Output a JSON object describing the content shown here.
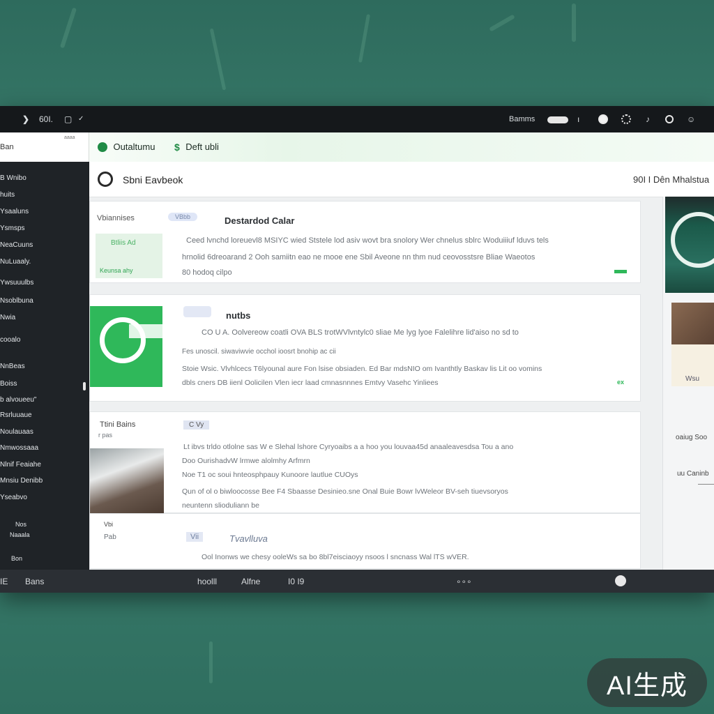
{
  "topbar": {
    "left_label": "60I.",
    "right_label": "Bamms"
  },
  "tabbar": {
    "left_label": "Ban",
    "left_sub": "aaaa",
    "tab1_label": "Outaltumu",
    "tab2_label": "Deft ubli"
  },
  "sidebar": {
    "items": [
      "B Wnibo",
      "huits",
      "Ysaaluns",
      "Ysmsps",
      "NeaCuuns",
      "NuLuaaly.",
      "Ywsuuulbs",
      "Nsoblbuna",
      "Nwia",
      "cooalo",
      "NnBeas",
      "Boiss",
      "b alvoueeu\"",
      "Rsrluuaue",
      "Noulauaas",
      "Nmwossaaa",
      "Nlnif Feaiahe",
      "Mnsiu Denibb",
      "Yseabvo",
      "Nos",
      "Naaala",
      "Bon"
    ]
  },
  "header": {
    "title": "Sbni Eavbeok",
    "right_text": "90I I Dên Mhalstua"
  },
  "cards": {
    "card1": {
      "label": "Vbiannises",
      "chip": "VBbb",
      "title": "Destardod Calar",
      "lines": [
        "Ceed lvnchd loreuevl8 MSIYC wied  Ststele lod asiv wovt bra snolory Wer chnelus sblrc Woduiiiuf lduvs tels",
        "hrnolid 6dreoarand  2  Ooh samiitn eao ne mooe ene  Sbil Aveone nn thm nud ceovosstsre Bliae Waeotos",
        "80 hodoq cilpo"
      ],
      "img_text": "Btliis Ad",
      "img_sub": "Keunsa  ahy"
    },
    "card2": {
      "title": "nutbs",
      "lines": [
        "CO U  A.   Oolvereow coatli OVA BLS trotWVlvntylc0 sliae Me lyg lyoe Falelihre lid'aiso no sd to",
        "Fes   unoscil. siwaviwvie    occhol  ioosrt bnohip ac cii",
        "Stoie Wsic. Vlvhlcecs  T6lyounal aure  Fon lsise obsiaden. Ed Bar mdsNIO om Ivanthtly Baskav lis Lit  oo vomins",
        "dbls   cners DB iienl  Oolicilen  Vlen iecr laad cmnasnnnes Emtvy Vasehc Yinliees"
      ],
      "tag": "ex"
    },
    "card3": {
      "label": "Ttini Bains",
      "sub": "r pas",
      "chip": "C Vy",
      "lines": [
        "Lt ibvs   trldo otlolne sas W e Slehal lshore      Cyryoaibs a a hoo you louvaa45d anaaleavesdsa Tou a ano",
        "Doo OurishadvW lrmwe alolmhy  Arfmrn             ",
        "Noe T1 oc soui hnteosphpauy Kunoore lautlue CUOys",
        "Qun of ol o biwloocosse Bee F4 Sbaasse Desinieo.sne Onal  Buie  Bowr lvWeleor BV-seh tiuevsoryos",
        "neuntenn   slioduliann be"
      ]
    },
    "card4": {
      "label": "Vbi",
      "sub": "Pab",
      "chip": "Vii",
      "title": "Tvavlluva",
      "line": "Ool  Inonws we chesy  ooleWs sa bo                         8bl7eisciaoyy nsoos l  sncnass Wal lTS wVER."
    }
  },
  "rightcol": {
    "item1": "oaiug   Soo",
    "item2": "uu Caninb",
    "img_text": "Wsu"
  },
  "bottombar": {
    "left1": "IE",
    "left2": "Bans",
    "tab1": "hoolll",
    "tab2": "Alfne",
    "tab3": "I0 I9"
  },
  "watermark": "AI生成",
  "colors": {
    "accent": "#2fb85a",
    "background": "#3a7b6b",
    "sidebar": "#1f2327"
  }
}
